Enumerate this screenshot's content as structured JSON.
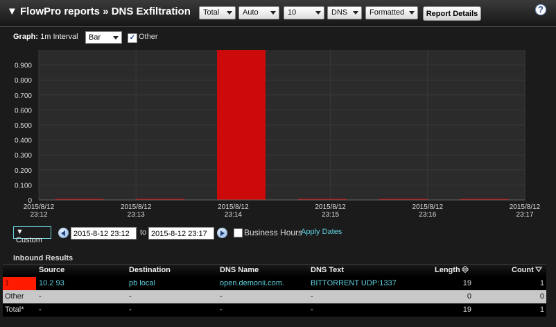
{
  "header": {
    "title": "▼ FlowPro reports » DNS Exfiltration",
    "selects": [
      "Total",
      "Auto",
      "10",
      "DNS",
      "Formatted"
    ],
    "report_button": "Report Details",
    "help": "?"
  },
  "graph_options": {
    "label": "Graph:",
    "interval": "1m Interval",
    "chart_type": "Bar",
    "other_label": "Other",
    "other_checked": true
  },
  "chart_data": {
    "type": "bar",
    "title": "",
    "xlabel": "",
    "ylabel": "",
    "ylim": [
      0,
      1.0
    ],
    "y_ticks": [
      "0",
      "0.100",
      "0.200",
      "0.300",
      "0.400",
      "0.500",
      "0.600",
      "0.700",
      "0.800",
      "0.900"
    ],
    "x_ticks": [
      {
        "date": "2015/8/12",
        "time": "23:12"
      },
      {
        "date": "2015/8/12",
        "time": "23:13"
      },
      {
        "date": "2015/8/12",
        "time": "23:14"
      },
      {
        "date": "2015/8/12",
        "time": "23:15"
      },
      {
        "date": "2015/8/12",
        "time": "23:16"
      },
      {
        "date": "2015/8/12",
        "time": "23:17"
      }
    ],
    "categories": [
      "23:12",
      "23:13",
      "23:14",
      "23:15",
      "23:16",
      "23:17"
    ],
    "values": [
      0,
      0,
      1,
      0,
      0,
      0
    ],
    "color": "#cc0a0a"
  },
  "date_range": {
    "range_button": "Custom",
    "start": "2015-8-12 23:12",
    "to_label": "to",
    "end": "2015-8-12 23:17",
    "business_hours_label": "Business Hours",
    "business_hours_checked": false,
    "apply_label": "Apply Dates"
  },
  "table": {
    "title": "Inbound Results",
    "columns": [
      "Source",
      "Destination",
      "DNS Name",
      "DNS Text",
      "Length",
      "Count"
    ],
    "rows": [
      {
        "key": "1",
        "source": "10.2 93",
        "destination": "pb local",
        "dns_name": "open.demonii.com.",
        "dns_text": "BITTORRENT UDP:1337",
        "length": "19",
        "count": "1"
      }
    ],
    "other_row": {
      "label": "Other",
      "source": "-",
      "destination": "-",
      "dns_name": "-",
      "dns_text": "-",
      "length": "0",
      "count": "0"
    },
    "total_row": {
      "label": "Total*",
      "source": "-",
      "destination": "-",
      "dns_name": "-",
      "dns_text": "-",
      "length": "19",
      "count": "1"
    },
    "swatch_color": "#ff1a00"
  }
}
